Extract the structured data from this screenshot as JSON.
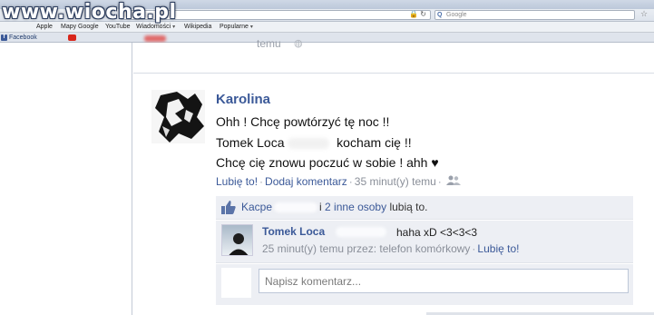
{
  "watermark": "www.wiocha.pl",
  "browser": {
    "search_placeholder": "Google",
    "bookmarks": [
      {
        "label": "Apple",
        "caret": false
      },
      {
        "label": "Mapy Google",
        "caret": false
      },
      {
        "label": "YouTube",
        "caret": false
      },
      {
        "label": "Wiadomości",
        "caret": true
      },
      {
        "label": "Wikipedia",
        "caret": false
      },
      {
        "label": "Popularne",
        "caret": true
      }
    ],
    "tabs": [
      {
        "label": "Facebook"
      }
    ]
  },
  "previous_post": {
    "time_fragment": "temu"
  },
  "post": {
    "author": "Karolina",
    "lines": [
      "Ohh ! Chcę powtórzyć tę noc !!",
      "Tomek Loca",
      "kocham cię !!",
      "Chcę cię znowu poczuć w sobie ! ahh ♥"
    ],
    "actions": {
      "like": "Lubię to!",
      "comment": "Dodaj komentarz",
      "time": "35 minut(y) temu"
    }
  },
  "likes": {
    "name_fragment": "Kacpe",
    "connector": "i",
    "others_link": "2 inne osoby",
    "suffix": "lubią to."
  },
  "comment": {
    "author": "Tomek Loca",
    "text": "haha xD <3<3<3",
    "meta": "25 minut(y) temu przez: telefon komórkowy",
    "like": "Lubię to!"
  },
  "write_comment": {
    "placeholder": "Napisz komentarz..."
  },
  "colors": {
    "facebook_blue": "#3b5998",
    "panel_bg": "#edeff4",
    "muted_text": "#8a8f99"
  }
}
